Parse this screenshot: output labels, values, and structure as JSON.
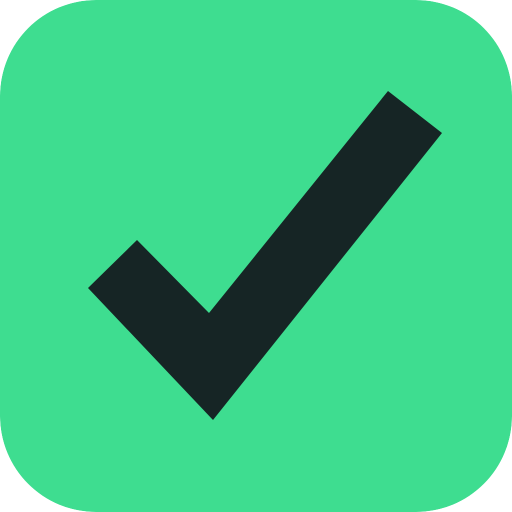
{
  "icon": {
    "name": "checkmark-icon",
    "background_color": "#3EDD90",
    "check_color": "#162525"
  }
}
